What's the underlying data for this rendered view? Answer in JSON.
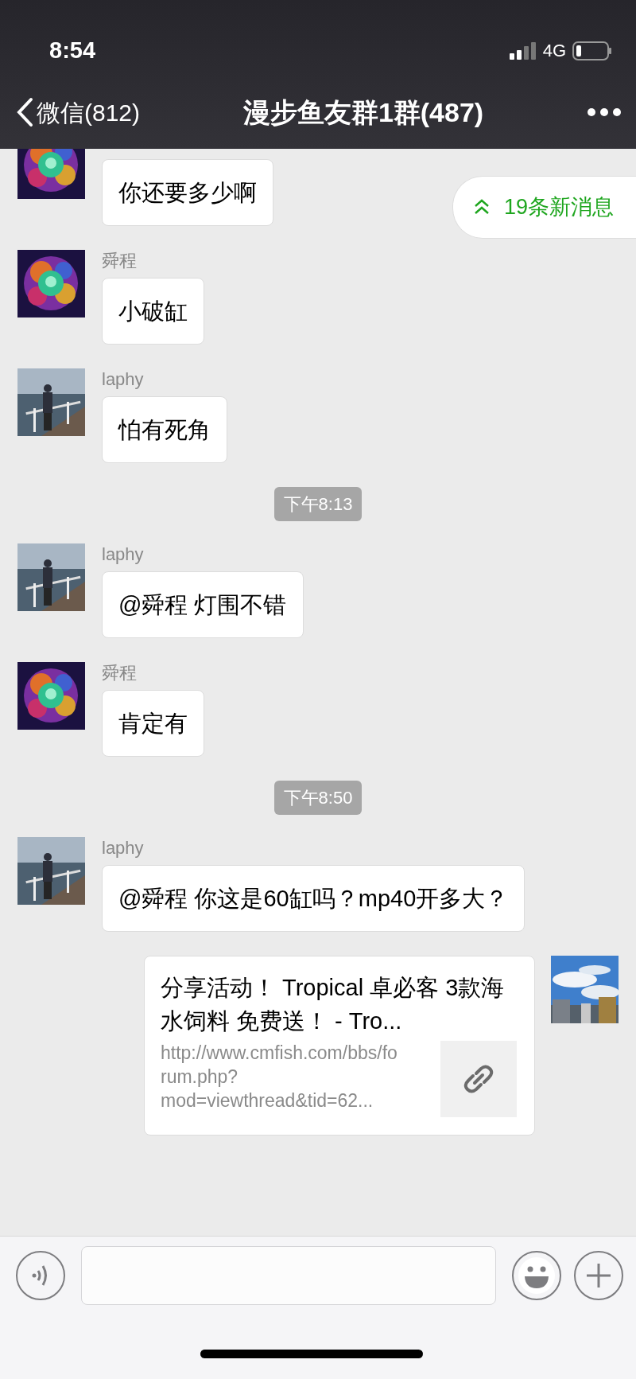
{
  "status_bar": {
    "time": "8:54",
    "network": "4G"
  },
  "nav": {
    "back_label": "微信(812)",
    "title": "漫步鱼友群1群(487)"
  },
  "new_messages": {
    "label": "19条新消息"
  },
  "messages": [
    {
      "kind": "incoming",
      "text": "你还要多少啊"
    },
    {
      "kind": "incoming",
      "sender": "舜程",
      "text": "小破缸"
    },
    {
      "kind": "incoming",
      "sender": "laphy",
      "text": "怕有死角"
    },
    {
      "kind": "time",
      "text": "下午8:13"
    },
    {
      "kind": "incoming",
      "sender": "laphy",
      "text": "@舜程 灯围不错"
    },
    {
      "kind": "incoming",
      "sender": "舜程",
      "text": "肯定有"
    },
    {
      "kind": "time",
      "text": "下午8:50"
    },
    {
      "kind": "incoming",
      "sender": "laphy",
      "text": "@舜程 你这是60缸吗？mp40开多大？"
    },
    {
      "kind": "outgoing_link",
      "title": "分享活动！ Tropical 卓必客 3款海水饲料 免费送！ - Tro...",
      "url": "http://www.cmfish.com/bbs/forum.php?mod=viewthread&tid=62..."
    }
  ]
}
